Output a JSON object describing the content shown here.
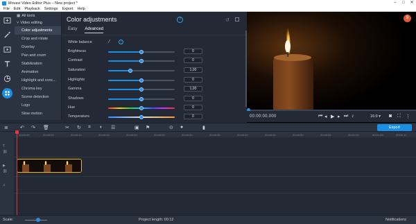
{
  "window": {
    "title": "Movavi Video Editor Plus – New project *"
  },
  "menu": [
    "File",
    "Edit",
    "Playback",
    "Settings",
    "Export",
    "Help"
  ],
  "tools": {
    "all_tools": "All tools",
    "group": "Video editing",
    "items": [
      "Color adjustments",
      "Crop and rotate",
      "Overlay",
      "Pan and zoom",
      "Stabilization",
      "Animation",
      "Highlight and conc...",
      "Chroma key",
      "Scene detection",
      "Logo",
      "Slow motion"
    ]
  },
  "panel": {
    "title": "Color adjustments",
    "tabs": [
      "Easy",
      "Advanced"
    ],
    "white_balance": "White balance",
    "sliders": [
      {
        "label": "Brightness",
        "value": "0",
        "level": 0.5
      },
      {
        "label": "Contrast",
        "value": "0",
        "level": 0.5
      },
      {
        "label": "Saturation",
        "value": "1,00",
        "level": 0.33
      },
      {
        "label": "Highlights",
        "value": "0",
        "level": 0.5
      },
      {
        "label": "Gamma",
        "value": "1,00",
        "level": 0.5
      },
      {
        "label": "Shadows",
        "value": "0",
        "level": 0.5
      },
      {
        "label": "Hue",
        "value": "0",
        "level": 0.5
      },
      {
        "label": "Temperature",
        "value": "0",
        "level": 0.5
      }
    ]
  },
  "preview": {
    "notification_count": "9",
    "time": "00:00:00.000",
    "aspect": "16:9 ▾"
  },
  "toolbar": {
    "export_label": "Export"
  },
  "ruler": [
    "00:00:00",
    "00:00:05",
    "00:00:10",
    "00:00:15",
    "00:00:20",
    "00:00:25",
    "00:00:30",
    "00:00:35",
    "00:00:40",
    "00:00:45",
    "00:00:50",
    "00:00:55",
    "00:01:00",
    "00:01:05",
    "00:01:10"
  ],
  "status": {
    "scale_label": "Scale:",
    "project_length": "Project length: 00:12",
    "notifications": "Notifications"
  },
  "colors": {
    "accent": "#1a8fe3",
    "clip_border": "#f0b81c",
    "playhead": "#e0393b"
  }
}
